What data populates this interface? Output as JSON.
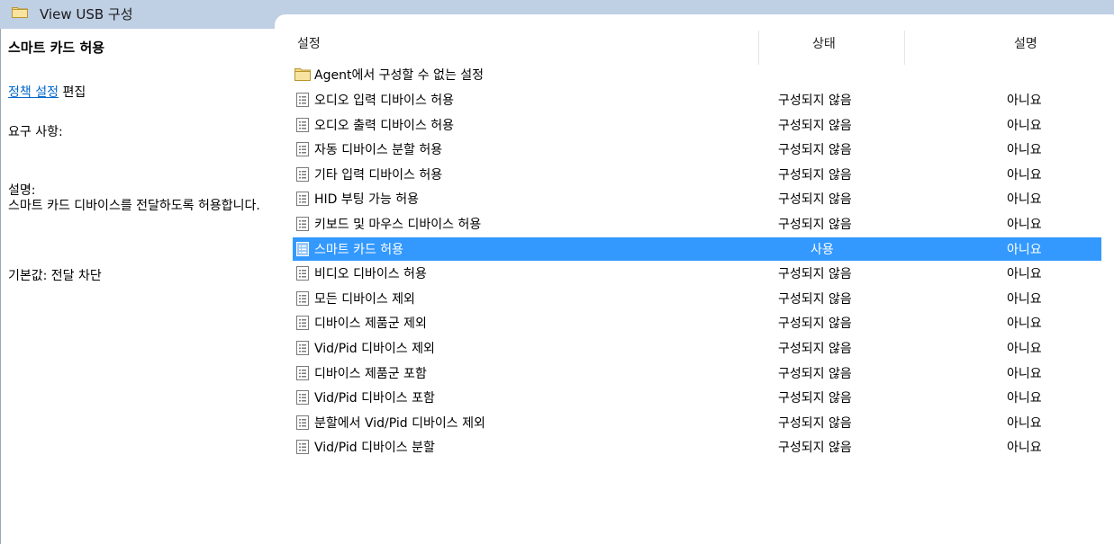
{
  "window": {
    "title": "View USB 구성"
  },
  "left_panel": {
    "title": "스마트 카드 허용",
    "edit_link": "정책 설정",
    "edit_suffix": "편집",
    "requirements": "요구 사항:",
    "description_label": "설명:",
    "description_text": "스마트 카드 디바이스를 전달하도록 허용합니다.",
    "default_text": "기본값: 전달 차단"
  },
  "table": {
    "headers": {
      "setting": "설정",
      "state": "상태",
      "comment": "설명"
    },
    "folder": {
      "name": "Agent에서 구성할 수 없는 설정",
      "icon": "folder-icon"
    },
    "rows": [
      {
        "name": "오디오 입력 디바이스 허용",
        "state": "구성되지 않음",
        "comment": "아니요",
        "selected": false
      },
      {
        "name": "오디오 출력 디바이스 허용",
        "state": "구성되지 않음",
        "comment": "아니요",
        "selected": false
      },
      {
        "name": "자동 디바이스 분할 허용",
        "state": "구성되지 않음",
        "comment": "아니요",
        "selected": false
      },
      {
        "name": "기타 입력 디바이스 허용",
        "state": "구성되지 않음",
        "comment": "아니요",
        "selected": false
      },
      {
        "name": "HID 부팅 가능 허용",
        "state": "구성되지 않음",
        "comment": "아니요",
        "selected": false
      },
      {
        "name": "키보드 및 마우스 디바이스 허용",
        "state": "구성되지 않음",
        "comment": "아니요",
        "selected": false
      },
      {
        "name": "스마트 카드 허용",
        "state": "사용",
        "comment": "아니요",
        "selected": true
      },
      {
        "name": "비디오 디바이스 허용",
        "state": "구성되지 않음",
        "comment": "아니요",
        "selected": false
      },
      {
        "name": "모든 디바이스 제외",
        "state": "구성되지 않음",
        "comment": "아니요",
        "selected": false
      },
      {
        "name": "디바이스 제품군 제외",
        "state": "구성되지 않음",
        "comment": "아니요",
        "selected": false
      },
      {
        "name": "Vid/Pid 디바이스 제외",
        "state": "구성되지 않음",
        "comment": "아니요",
        "selected": false
      },
      {
        "name": "디바이스 제품군 포함",
        "state": "구성되지 않음",
        "comment": "아니요",
        "selected": false
      },
      {
        "name": "Vid/Pid 디바이스 포함",
        "state": "구성되지 않음",
        "comment": "아니요",
        "selected": false
      },
      {
        "name": "분할에서 Vid/Pid 디바이스 제외",
        "state": "구성되지 않음",
        "comment": "아니요",
        "selected": false
      },
      {
        "name": "Vid/Pid 디바이스 분할",
        "state": "구성되지 않음",
        "comment": "아니요",
        "selected": false
      }
    ]
  },
  "colors": {
    "selection": "#3399ff",
    "titlebar": "#bfcfe4",
    "link": "#0066cc"
  }
}
